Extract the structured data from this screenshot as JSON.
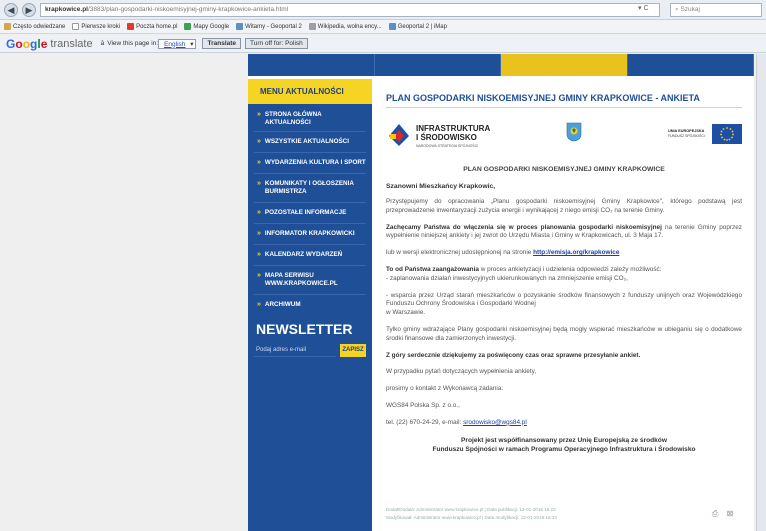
{
  "browser": {
    "url_domain": "krapkowice.pl",
    "url_rest": "/3883/plan-gospodarki-niskoemisyjnej-gminy-krapkowice-ankieta.html",
    "search_placeholder": "Szukaj",
    "bookmarks": [
      {
        "label": "Często odwiedzane",
        "color": "#d8a54a"
      },
      {
        "label": "Pierwsze kroki",
        "color": "#e0e0e0"
      },
      {
        "label": "Poczta home.pl",
        "color": "#e03a2c"
      },
      {
        "label": "Mapy Google",
        "color": "#3fa14f"
      },
      {
        "label": "Witamy - Geoportal 2",
        "color": "#5c8fc5"
      },
      {
        "label": "Wikipedia, wolna ency...",
        "color": "#9aa0a6"
      },
      {
        "label": "Geoportal 2 | iMap",
        "color": "#5c8fc5"
      }
    ]
  },
  "google_translate": {
    "logo": "Google",
    "product": "translate",
    "view_text": "View this page in:",
    "language": "English",
    "translate_button": "Translate",
    "turn_off_button": "Turn off for: Polish"
  },
  "sidebar": {
    "menu_title": "MENU AKTUALNOŚCI",
    "items": [
      "STRONA GŁÓWNA AKTUALNOŚCI",
      "WSZYSTKIE AKTUALNOŚCI",
      "WYDARZENIA KULTURA I SPORT",
      "KOMUNIKATY I OGŁOSZENIA BURMISTRZA",
      "POZOSTAŁE INFORMACJE",
      "INFORMATOR KRAPKOWICKI",
      "KALENDARZ WYDARZEŃ",
      "MAPA SERWISU WWW.KRAPKOWICE.PL",
      "ARCHIWUM"
    ],
    "newsletter_title": "NEWSLETTER",
    "newsletter_placeholder": "Podaj adres e-mail",
    "newsletter_button": "ZAPISZ"
  },
  "article": {
    "title": "PLAN GOSPODARKI NISKOEMISYJNEJ GMINY KRAPKOWICE - ANKIETA",
    "logo_ii_line1": "INFRASTRUKTURA",
    "logo_ii_line2": "I ŚRODOWISKO",
    "logo_ii_line3": "NARODOWA STRATEGIA SPÓJNOŚCI",
    "logo_ue_line1": "UNIA EUROPEJSKA",
    "logo_ue_line2": "FUNDUSZ SPÓJNOŚCI",
    "subtitle": "PLAN GOSPODARKI NISKOEMISYJNEJ GMINY KRAPKOWICE",
    "greeting": "Szanowni Mieszkańcy Krapkowic,",
    "p1": "Przystępujemy do opracowania „Planu gospodarki niskoemisyjnej Gminy Krapkowice\", którego podstawą jest przeprowadzenie inwentaryzacji zużycia energii i wynikającej z niego emisji CO₂ na terenie Gminy.",
    "p2_bold": "Zachęcamy Państwa do włączenia się w proces planowania gospodarki niskoemisyjnej",
    "p2_rest": " na terenie Gminy poprzez wypełnienie niniejszej ankiety i jej zwrot do Urzędu Miasta i Gminy w Krapkowicach, ul. 3 Maja 17.",
    "p3_text": "lub w wersji elektronicznej udostępnionej na stronie ",
    "p3_link": "http://emisja.org/krapkowice",
    "p4_bold": "To od Państwa zaangażowania",
    "p4_rest": " w proces ankietyzacji i udzielenia odpowiedzi zależy możliwość:",
    "p4_line2": "- zaplanowania działań inwestycyjnych ukierunkowanych na zmniejszenie emisji CO₂,",
    "p5": "- wsparcia przez Urząd starań mieszkańców o pozyskanie środków finansowych z funduszy unijnych oraz Wojewódzkiego Funduszu Ochrony Środowiska i Gospodarki Wodnej",
    "p5_line2": "w Warszawie.",
    "p6": "Tylko gminy wdrażające Plany gospodarki niskoemisyjnej będą mogły wspierać mieszkańców w ubieganiu się o dodatkowe środki finansowe dla zamierzonych inwestycji.",
    "p7": "Z góry serdecznie dziękujemy za poświęcony czas oraz sprawne przesyłanie ankiet.",
    "p8": "W przypadku pytań dotyczących wypełnienia ankiety,",
    "p9": "prosimy o kontakt z Wykonawcą zadania:",
    "p10": "WGS84 Polska Sp. z o.o.,",
    "p11_text": "tel. (22) 670-24-29, e-mail: ",
    "p11_link": "srodowisko@wgs84.pl",
    "footnote1": "Projekt jest współfinansowany przez Unię Europejską ze środków",
    "footnote2": "Funduszu Spójności w ramach Programu Operacyjnego Infrastruktura i Środowisko",
    "meta1": "Dodał/Dodała: Administrator www.krapkowice.pl  |  Data publikacji: 12-01-2015 16:23",
    "meta2": "Modyfikował: Administrator www.krapkowice.pl  |  Data modyfikacji: 12-01-2015 16:34"
  },
  "colors": {
    "primary_blue": "#1f4f97",
    "accent_yellow": "#f5d424"
  }
}
